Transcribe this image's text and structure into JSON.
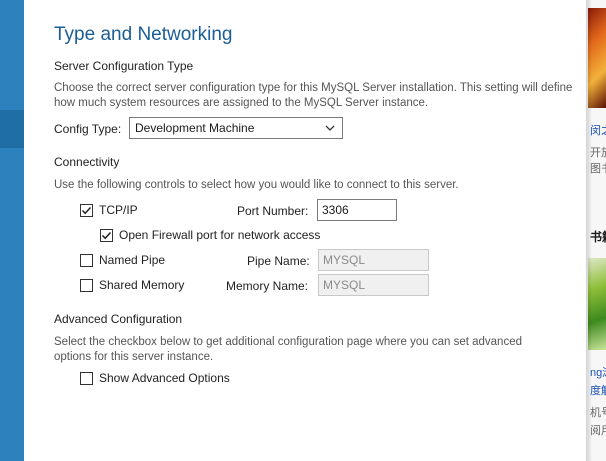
{
  "page": {
    "title": "Type and Networking"
  },
  "server_config": {
    "heading": "Server Configuration Type",
    "description": "Choose the correct server configuration type for this MySQL Server installation. This setting will define how much system resources are assigned to the MySQL Server instance.",
    "config_type_label": "Config Type:",
    "config_type_value": "Development Machine"
  },
  "connectivity": {
    "heading": "Connectivity",
    "description": "Use the following controls to select how you would like to connect to this server.",
    "tcpip": {
      "label": "TCP/IP",
      "checked": true
    },
    "port_label": "Port Number:",
    "port_value": "3306",
    "firewall": {
      "label": "Open Firewall port for network access",
      "checked": true
    },
    "named_pipe": {
      "label": "Named Pipe",
      "checked": false
    },
    "pipe_name_label": "Pipe Name:",
    "pipe_name_value": "MYSQL",
    "shared_memory": {
      "label": "Shared Memory",
      "checked": false
    },
    "memory_name_label": "Memory Name:",
    "memory_name_value": "MYSQL"
  },
  "advanced": {
    "heading": "Advanced Configuration",
    "description": "Select the checkbox below to get additional configuration page where you can set advanced options for this server instance.",
    "show_advanced": {
      "label": "Show Advanced Options",
      "checked": false
    }
  },
  "background_page": {
    "snippets": [
      "闵之",
      "开放",
      "图书",
      "书籍",
      "ng滩",
      "度解",
      "机号",
      "阅用"
    ]
  },
  "colors": {
    "accent_blue": "#2d82be",
    "title_blue": "#1b5e96"
  },
  "icons": {
    "dropdown": "chevron-down-icon",
    "check": "checkmark-icon"
  }
}
